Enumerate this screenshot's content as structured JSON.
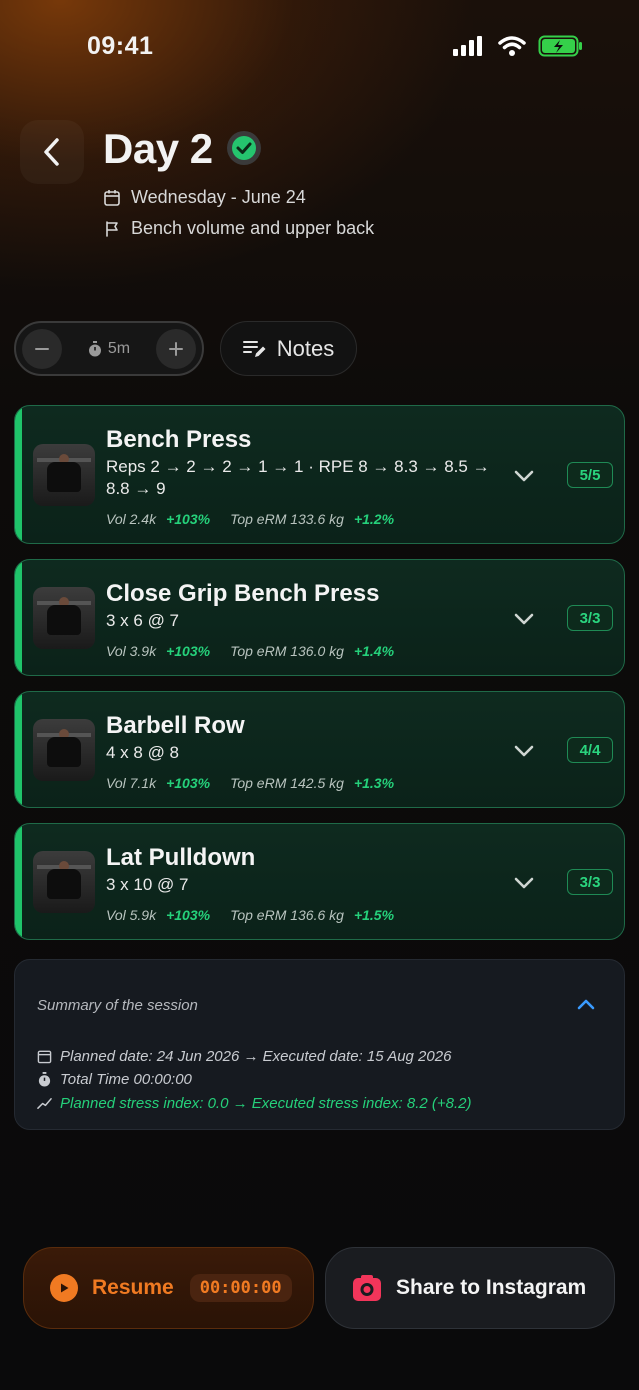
{
  "status_bar": {
    "time": "09:41"
  },
  "header": {
    "title": "Day 2",
    "date": "Wednesday - June 24",
    "focus": "Bench volume and upper back"
  },
  "controls": {
    "timer_value": "5m",
    "notes_label": "Notes"
  },
  "exercises": [
    {
      "name": "Bench Press",
      "sets": "Reps 2 → 2 → 2 → 1 → 1 · RPE 8 → 8.3 → 8.5 → 8.8 → 9",
      "vol": "Vol 2.4k",
      "vol_pct": "+103%",
      "erm": "Top eRM 133.6 kg",
      "erm_pct": "+1.2%",
      "count": "5/5"
    },
    {
      "name": "Close Grip Bench Press",
      "sets": "3 x 6 @ 7",
      "vol": "Vol 3.9k",
      "vol_pct": "+103%",
      "erm": "Top eRM 136.0 kg",
      "erm_pct": "+1.4%",
      "count": "3/3"
    },
    {
      "name": "Barbell Row",
      "sets": "4 x 8 @ 8",
      "vol": "Vol 7.1k",
      "vol_pct": "+103%",
      "erm": "Top eRM 142.5 kg",
      "erm_pct": "+1.3%",
      "count": "4/4"
    },
    {
      "name": "Lat Pulldown",
      "sets": "3 x 10 @ 7",
      "vol": "Vol 5.9k",
      "vol_pct": "+103%",
      "erm": "Top eRM 136.6 kg",
      "erm_pct": "+1.5%",
      "count": "3/3"
    }
  ],
  "summary": {
    "title": "Summary of the session",
    "dates": "Planned date: 24 Jun 2026 → Executed date: 15 Aug 2026",
    "total_time": "Total Time 00:00:00",
    "stress": "Planned stress index: 0.0 → Executed stress index: 8.2 (+8.2)"
  },
  "footer": {
    "resume_label": "Resume",
    "resume_time": "00:00:00",
    "share_label": "Share to Instagram"
  },
  "colors": {
    "accent_green": "#25d07a",
    "accent_orange": "#f07a22",
    "card_border": "#1f6a48"
  }
}
